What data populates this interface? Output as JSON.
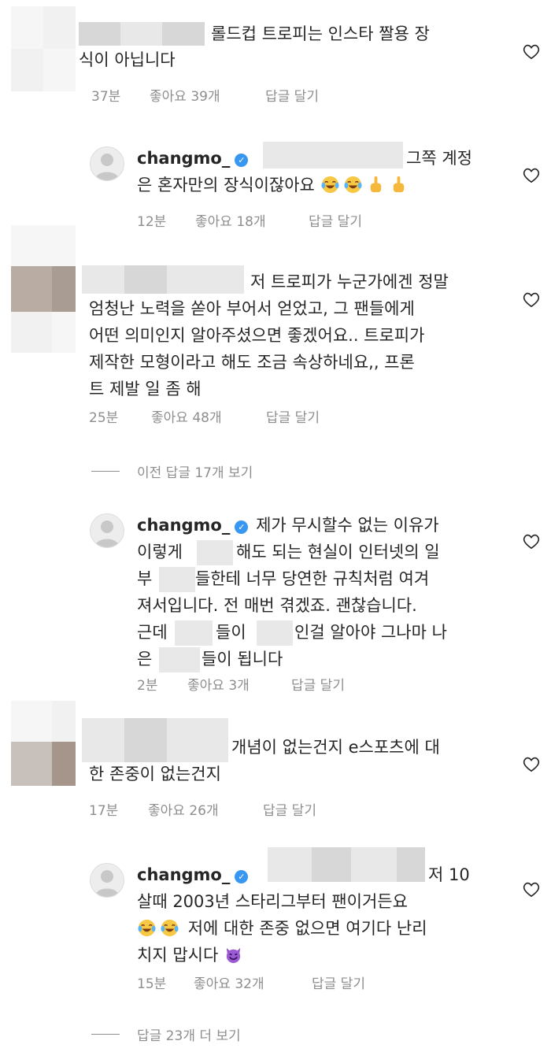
{
  "comments": [
    {
      "lines": [
        "롤드컵 트로피는 인스타 짤용 장",
        "식이 아닙니다"
      ],
      "time": "37분",
      "likes": "좋아요 39개",
      "reply": "답글 달기"
    },
    {
      "username": "changmo_",
      "lines": [
        "그쪽 계정",
        "은 혼자만의 장식이잖아요"
      ],
      "time": "12분",
      "likes": "좋아요 18개",
      "reply": "답글 달기"
    },
    {
      "lines": [
        "저 트로피가 누군가에겐 정말",
        "엄청난 노력을 쏟아 부어서 얻었고, 그 팬들에게",
        "어떤 의미인지 알아주셨으면 좋겠어요.. 트로피가",
        "제작한 모형이라고 해도 조금 속상하네요,, 프론",
        "트 제발 일 좀 해"
      ],
      "time": "25분",
      "likes": "좋아요 48개",
      "reply": "답글 달기"
    },
    {
      "username": "changmo_",
      "line1": "제가 무시할수 없는 이유가",
      "line2_a": "이렇게",
      "line2_b": "해도 되는 현실이 인터넷의 일",
      "line3_a": "부",
      "line3_b": "들한테 너무 당연한 규칙처럼 여겨",
      "line4": "져서입니다. 전 매번 겪겠죠. 괜찮습니다.",
      "line5_a": "근데",
      "line5_b": "들이",
      "line5_c": "인걸 알아야 그나마 나",
      "line6_a": "은",
      "line6_b": "들이 됩니다",
      "time": "2분",
      "likes": "좋아요 3개",
      "reply": "답글 달기"
    },
    {
      "lines": [
        "개념이 없는건지 e스포츠에 대",
        "한 존중이 없는건지"
      ],
      "time": "17분",
      "likes": "좋아요 26개",
      "reply": "답글 달기"
    },
    {
      "username": "changmo_",
      "lines": [
        "저 10",
        "살때 2003년 스타리그부터 팬이거든요",
        "저에 대한 존중 없으면 여기다 난리",
        "치지 맙시다"
      ],
      "time": "15분",
      "likes": "좋아요 32개",
      "reply": "답글 달기"
    }
  ],
  "view_prev_replies": "이전 답글 17개 보기",
  "view_more_replies": "답글 23개 더 보기",
  "icons": {
    "verified": "verified-badge-icon",
    "heart": "heart-outline-icon",
    "laugh": "face-with-tears-of-joy-icon",
    "finger": "middle-finger-icon",
    "devil": "smiling-devil-icon"
  },
  "colors": {
    "verified": "#3897f0",
    "meta": "#8e8e8e",
    "text": "#262626"
  }
}
